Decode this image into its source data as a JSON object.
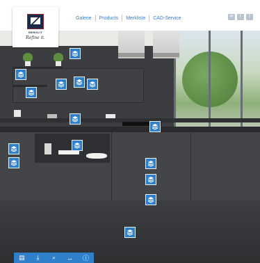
{
  "logo": {
    "brand": "RENOLIT",
    "tagline": "Refine it."
  },
  "nav": {
    "items": [
      "Galerie",
      "Products",
      "Merkliste",
      "CAD-Service"
    ]
  },
  "social": [
    {
      "icon": "email-icon",
      "glyph": "✉"
    },
    {
      "icon": "twitter-icon",
      "glyph": "t"
    },
    {
      "icon": "facebook-icon",
      "glyph": "f"
    }
  ],
  "hotspots": {
    "icon": "layers-icon",
    "count": 17,
    "color": "#2f7fcb"
  },
  "toolbar": [
    {
      "icon": "document-icon",
      "glyph": "▤"
    },
    {
      "icon": "download-icon",
      "glyph": "⤓"
    },
    {
      "icon": "zoom-icon",
      "glyph": "⌕"
    },
    {
      "icon": "fit-width-icon",
      "glyph": "↔"
    },
    {
      "icon": "info-icon",
      "glyph": "ⓘ"
    }
  ],
  "colors": {
    "accent": "#2f7fcb",
    "nav_link": "#3a7cc8"
  }
}
